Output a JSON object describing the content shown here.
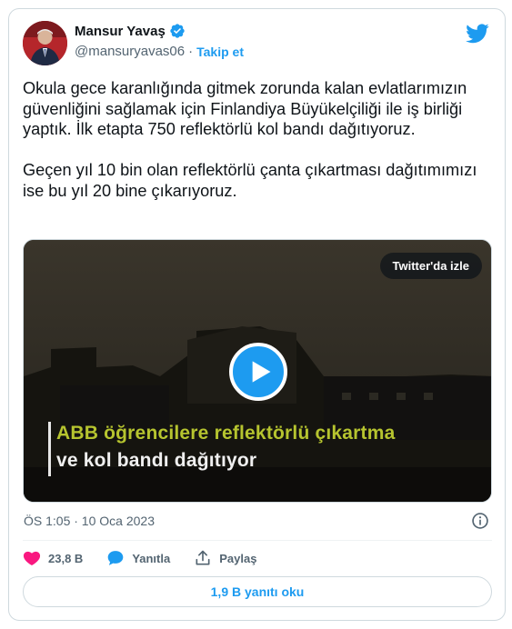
{
  "user": {
    "display_name": "Mansur Yavaş",
    "handle": "@mansuryavas06",
    "separator": "·",
    "follow_label": "Takip et"
  },
  "tweet": {
    "text": "Okula gece karanlığında gitmek zorunda kalan evlatlarımızın güvenliğini sağlamak için Finlandiya Büyükelçiliği ile iş birliği yaptık. İlk etapta 750 reflektörlü kol bandı dağıtıyoruz.\n\nGeçen yıl 10 bin olan reflektörlü çanta çıkartması dağıtımımızı ise bu yıl 20 bine çıkarıyoruz."
  },
  "media": {
    "watch_label": "Twitter'da izle",
    "caption_line1": "ABB öğrencilere reflektörlü çıkartma",
    "caption_line2": "ve kol bandı dağıtıyor"
  },
  "meta": {
    "timestamp": "ÖS 1:05 · 10 Oca 2023"
  },
  "actions": {
    "likes": "23,8 B",
    "reply_label": "Yanıtla",
    "share_label": "Paylaş"
  },
  "replies_button": "1,9 B yanıtı oku",
  "colors": {
    "accent": "#1d9bf0",
    "like": "#f91880",
    "caption_highlight": "#b6c42f"
  },
  "icons": [
    "verified-badge-icon",
    "twitter-bird-icon",
    "play-icon",
    "info-icon",
    "heart-icon",
    "reply-bubble-icon",
    "share-icon"
  ]
}
